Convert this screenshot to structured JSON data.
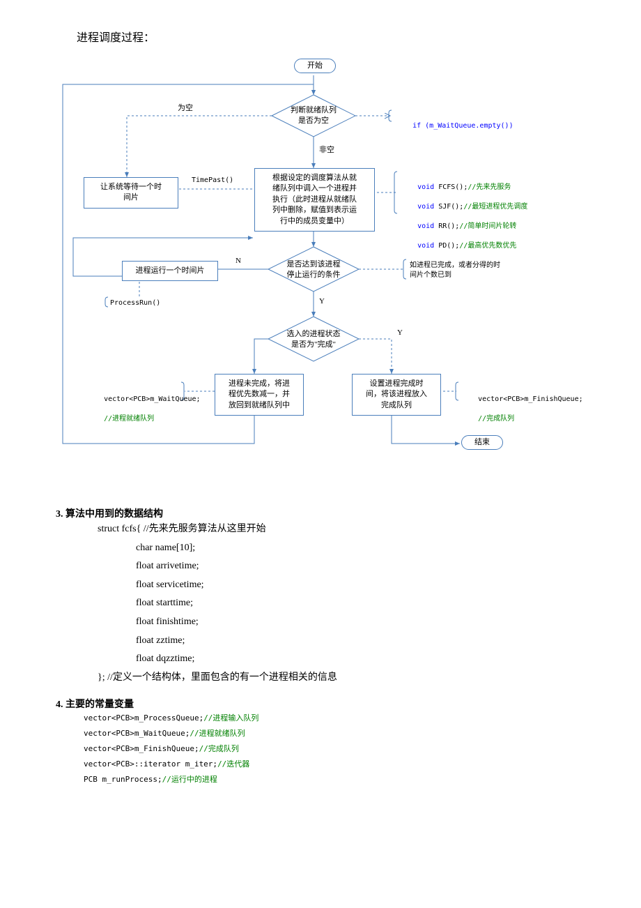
{
  "title": "进程调度过程：",
  "flow": {
    "start": "开始",
    "decision1": "判断就绪队列\n是否为空",
    "edge_empty": "为空",
    "edge_nonempty": "非空",
    "anno_if": "if (m_WaitQueue.empty())",
    "wait_box": "让系统等待一个时\n间片",
    "anno_timepast": "TimePast()",
    "dispatch_box": "根据设定的调度算法从就\n绪队列中调入一个进程并\n执行（此时进程从就绪队\n列中删除，赋值到表示运\n行中的成员变量中）",
    "anno_algo_void": "void",
    "anno_algo_fcfs": " FCFS();",
    "anno_algo_fcfs_c": "//先来先服务",
    "anno_algo_sjf": " SJF();",
    "anno_algo_sjf_c": "//最短进程优先调度",
    "anno_algo_rr": " RR();",
    "anno_algo_rr_c": "//简单时间片轮转",
    "anno_algo_pd": " PD();",
    "anno_algo_pd_c": "//最高优先数优先",
    "decision2": "是否达到该进程\n停止运行的条件",
    "edge_n": "N",
    "edge_y1": "Y",
    "run_box": "进程运行一个时间片",
    "anno_processrun": "ProcessRun()",
    "anno_stop_cond": "如进程已完成，或者分得的时\n间片个数已到",
    "decision3": "选入的进程状态\n是否为\"完成\"",
    "edge_y2": "Y",
    "notdone_box": "进程未完成，将进\n程优先数减一，并\n放回到就绪队列中",
    "anno_waitqueue_code": "vector<PCB>m_WaitQueue;",
    "anno_waitqueue_c": "//进程就绪队列",
    "done_box": "设置进程完成时\n间，将该进程放入\n完成队列",
    "anno_finishqueue_code": "vector<PCB>m_FinishQueue;",
    "anno_finishqueue_c": "//完成队列",
    "end": "结束"
  },
  "section3": {
    "title": "3.  算法中用到的数据结构",
    "lines": [
      "struct fcfs{      //先来先服务算法从这里开始",
      "char name[10];",
      "float arrivetime;",
      "float servicetime;",
      "float starttime;",
      "float finishtime;",
      "float zztime;",
      "float dqzztime;",
      "};     //定义一个结构体，里面包含的有一个进程相关的信息"
    ]
  },
  "section4": {
    "title": "4.  主要的常量变量",
    "vars": [
      {
        "code": "vector<PCB>m_ProcessQueue;",
        "comment": "//进程输入队列"
      },
      {
        "code": "vector<PCB>m_WaitQueue;",
        "comment": "//进程就绪队列"
      },
      {
        "code": "vector<PCB>m_FinishQueue;",
        "comment": "//完成队列"
      },
      {
        "code": "vector<PCB>::iterator m_iter;",
        "comment": "//迭代器"
      },
      {
        "code": "PCB m_runProcess;",
        "comment": "//运行中的进程"
      }
    ]
  }
}
